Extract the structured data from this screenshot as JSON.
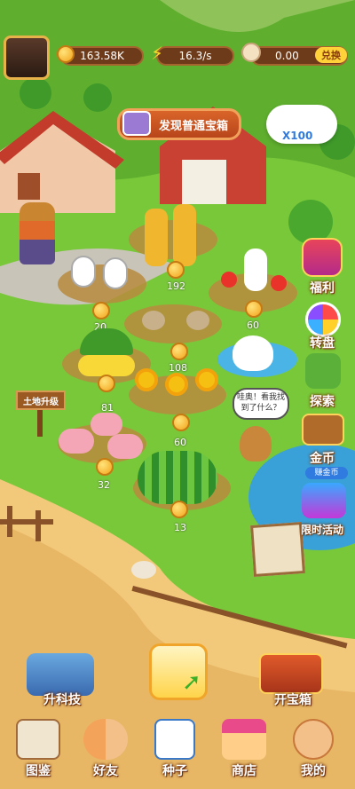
{
  "top_bar": {
    "coins": "163.58K",
    "rate": "16.3/s",
    "currency": "0.00",
    "exchange_label": "兑换"
  },
  "chest_button": {
    "label": "发现普通宝箱"
  },
  "cloud_counter": "X100",
  "sign_upgrade": "土地升级",
  "speech": "哇奥！看我找到了什么？",
  "plot_counts": {
    "rabbits": "",
    "giraffes": "192",
    "flowers": "20",
    "strawberry": "60",
    "banana": "108",
    "sunflower": "60",
    "pigs": "81",
    "pigs2": "32",
    "watermelon": "13"
  },
  "side_menu": [
    {
      "label": "福利"
    },
    {
      "label": "转盘"
    },
    {
      "label": "探索"
    },
    {
      "label": "金币",
      "sub": "赚金币"
    },
    {
      "label": "限时活动"
    }
  ],
  "tech_button": "升科技",
  "open_chest_button": "开宝箱",
  "bottom_nav": [
    {
      "label": "图鉴"
    },
    {
      "label": "好友"
    },
    {
      "label": "种子"
    },
    {
      "label": "商店"
    },
    {
      "label": "我的"
    }
  ]
}
